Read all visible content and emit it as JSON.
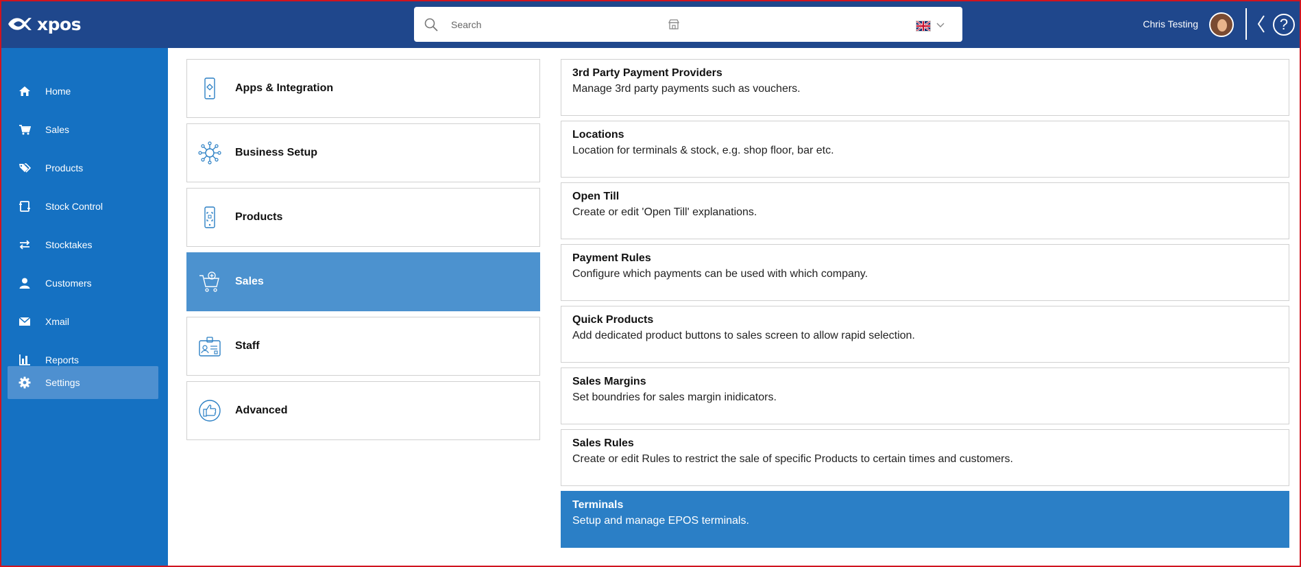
{
  "app": {
    "name": "xpos"
  },
  "header": {
    "search_placeholder": "Search",
    "user_name": "Chris Testing",
    "help_glyph": "?"
  },
  "sidebar": {
    "items": [
      {
        "label": "Home",
        "icon": "home-icon"
      },
      {
        "label": "Sales",
        "icon": "cart-icon"
      },
      {
        "label": "Products",
        "icon": "tags-icon"
      },
      {
        "label": "Stock Control",
        "icon": "stock-icon"
      },
      {
        "label": "Stocktakes",
        "icon": "swap-icon"
      },
      {
        "label": "Customers",
        "icon": "user-icon"
      },
      {
        "label": "Xmail",
        "icon": "mail-icon"
      },
      {
        "label": "Reports",
        "icon": "bar-chart-icon"
      },
      {
        "label": "Settings",
        "icon": "gear-icon",
        "active": true
      }
    ]
  },
  "categories": [
    {
      "label": "Apps & Integration",
      "icon": "phone-app-icon"
    },
    {
      "label": "Business Setup",
      "icon": "network-icon"
    },
    {
      "label": "Products",
      "icon": "phone-scan-icon"
    },
    {
      "label": "Sales",
      "icon": "cart-add-icon",
      "active": true
    },
    {
      "label": "Staff",
      "icon": "id-card-icon"
    },
    {
      "label": "Advanced",
      "icon": "thumbs-up-icon"
    }
  ],
  "options": [
    {
      "title": "3rd Party Payment Providers",
      "desc": "Manage 3rd party payments such as vouchers."
    },
    {
      "title": "Locations",
      "desc": "Location for terminals & stock, e.g. shop floor, bar etc."
    },
    {
      "title": "Open Till",
      "desc": "Create or edit 'Open Till' explanations."
    },
    {
      "title": "Payment Rules",
      "desc": "Configure which payments can be used with which company."
    },
    {
      "title": "Quick Products",
      "desc": "Add dedicated product buttons to sales screen to allow rapid selection."
    },
    {
      "title": "Sales Margins",
      "desc": "Set boundries for sales margin inidicators."
    },
    {
      "title": "Sales Rules",
      "desc": "Create or edit Rules to restrict the sale of specific Products to certain times and customers."
    },
    {
      "title": "Terminals",
      "desc": "Setup and manage EPOS terminals.",
      "active": true
    }
  ],
  "colors": {
    "topbar": "#1f478c",
    "sidebar": "#1571c2",
    "sidebar_active": "#4e90d0",
    "category_active": "#4c92cf",
    "option_active": "#2b7fc6",
    "icon_stroke": "#2a7fc4"
  }
}
